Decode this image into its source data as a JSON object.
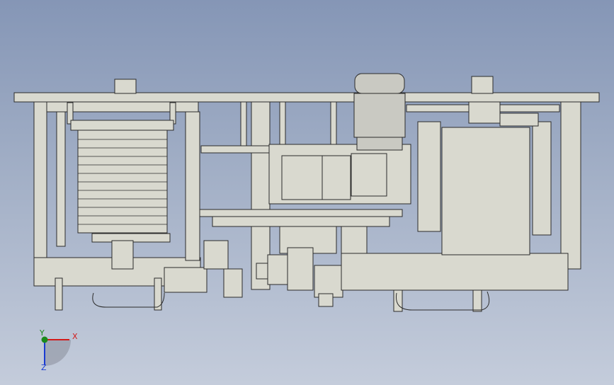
{
  "scene": {
    "kind": "cad-assembly-front-view",
    "background": {
      "top": "#8596b6",
      "bottom": "#c4ccdb"
    },
    "part_color": "#d9d9cf",
    "edge_color": "#2b2b2b",
    "motor_color": "#c9c9c2"
  },
  "triad": {
    "x_label": "X",
    "y_label": "Y",
    "z_label": "Z",
    "x_color": "#d21a1a",
    "y_color": "#1b8a1b",
    "z_color": "#1a3bd2"
  }
}
